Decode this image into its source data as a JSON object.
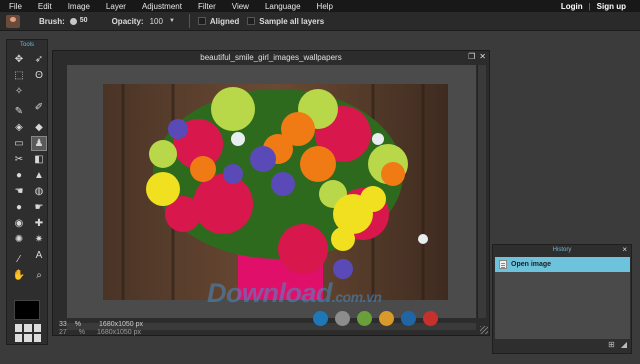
{
  "menu": {
    "items": [
      "File",
      "Edit",
      "Image",
      "Layer",
      "Adjustment",
      "Filter",
      "View",
      "Language",
      "Help"
    ],
    "login": "Login",
    "separator": "|",
    "signup": "Sign up"
  },
  "options": {
    "tool_icon": "clone-stamp-icon",
    "brush_label": "Brush:",
    "brush_size": "50",
    "opacity_label": "Opacity:",
    "opacity_value": "100",
    "aligned_label": "Aligned",
    "sample_all_label": "Sample all layers"
  },
  "tools": {
    "title": "Tools",
    "items": [
      {
        "name": "move-icon",
        "glyph": "✥"
      },
      {
        "name": "lasso-arrow-icon",
        "glyph": "➶"
      },
      {
        "name": "marquee-icon",
        "glyph": "⬚"
      },
      {
        "name": "lasso-icon",
        "glyph": "ʘ"
      },
      {
        "name": "magic-wand-icon",
        "glyph": "✧"
      },
      {
        "name": "blank-icon",
        "glyph": ""
      },
      {
        "name": "pencil-icon",
        "glyph": "✎"
      },
      {
        "name": "brush-icon",
        "glyph": "✐"
      },
      {
        "name": "eraser-icon",
        "glyph": "◈"
      },
      {
        "name": "paint-bucket-icon",
        "glyph": "◆"
      },
      {
        "name": "gradient-icon",
        "glyph": "▭"
      },
      {
        "name": "clone-stamp-icon",
        "glyph": "♟"
      },
      {
        "name": "color-replace-icon",
        "glyph": "✂"
      },
      {
        "name": "shape-icon",
        "glyph": "◧"
      },
      {
        "name": "blur-icon",
        "glyph": "●"
      },
      {
        "name": "sharpen-icon",
        "glyph": "▲"
      },
      {
        "name": "smudge-icon",
        "glyph": "☚"
      },
      {
        "name": "sponge-icon",
        "glyph": "◍"
      },
      {
        "name": "dodge-icon",
        "glyph": "●"
      },
      {
        "name": "burn-icon",
        "glyph": "☛"
      },
      {
        "name": "red-eye-icon",
        "glyph": "◉"
      },
      {
        "name": "spot-heal-icon",
        "glyph": "✚"
      },
      {
        "name": "bloat-icon",
        "glyph": "✺"
      },
      {
        "name": "pinch-icon",
        "glyph": "✷"
      },
      {
        "name": "eyedropper-icon",
        "glyph": "⁄"
      },
      {
        "name": "type-icon",
        "glyph": "A"
      },
      {
        "name": "hand-icon",
        "glyph": "✋"
      },
      {
        "name": "zoom-icon",
        "glyph": "⌕"
      }
    ]
  },
  "window": {
    "title": "beautiful_smile_girl_images_wallpapers",
    "restore_icon": "❐",
    "close_icon": "✕",
    "zoom_value": "33",
    "zoom_unit": "%",
    "dimensions": "1680x1050 px",
    "zoom_value_2": "27",
    "zoom_unit_2": "%",
    "dimensions_2": "1680x1050 px"
  },
  "history": {
    "title": "History",
    "close_icon": "×",
    "item": "Open image"
  },
  "watermark": {
    "text": "Download",
    "suffix": ".com.vn"
  },
  "colors": {
    "accent": "#6ec3dc",
    "dots": [
      "#1e78b8",
      "#8c8c8c",
      "#6aa03c",
      "#d89a2a",
      "#2066a4",
      "#c8302e"
    ]
  }
}
